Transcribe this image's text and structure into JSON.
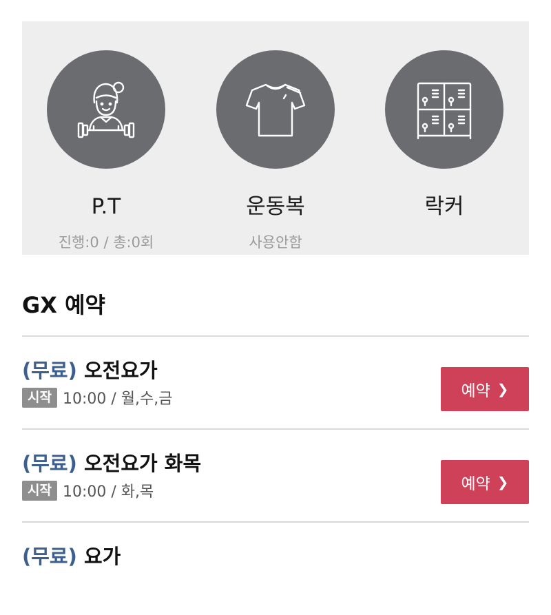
{
  "services": [
    {
      "icon": "trainer-icon",
      "title": "P.T",
      "subtitle": "진행:0 / 총:0회"
    },
    {
      "icon": "sportswear-icon",
      "title": "운동복",
      "subtitle": "사용안함"
    },
    {
      "icon": "locker-icon",
      "title": "락커",
      "subtitle": ""
    }
  ],
  "gx": {
    "title": "GX 예약",
    "items": [
      {
        "free_label": "(무료)",
        "name": "오전요가",
        "badge": "시작",
        "schedule": "10:00 / 월,수,금",
        "button": "예약"
      },
      {
        "free_label": "(무료)",
        "name": "오전요가 화목",
        "badge": "시작",
        "schedule": "10:00 / 화,목",
        "button": "예약"
      },
      {
        "free_label": "(무료)",
        "name": "요가"
      }
    ]
  },
  "colors": {
    "accent": "#cf4159",
    "free_label": "#3d5f8f",
    "circle": "#6b6c6f",
    "panel": "#eeeeee"
  }
}
